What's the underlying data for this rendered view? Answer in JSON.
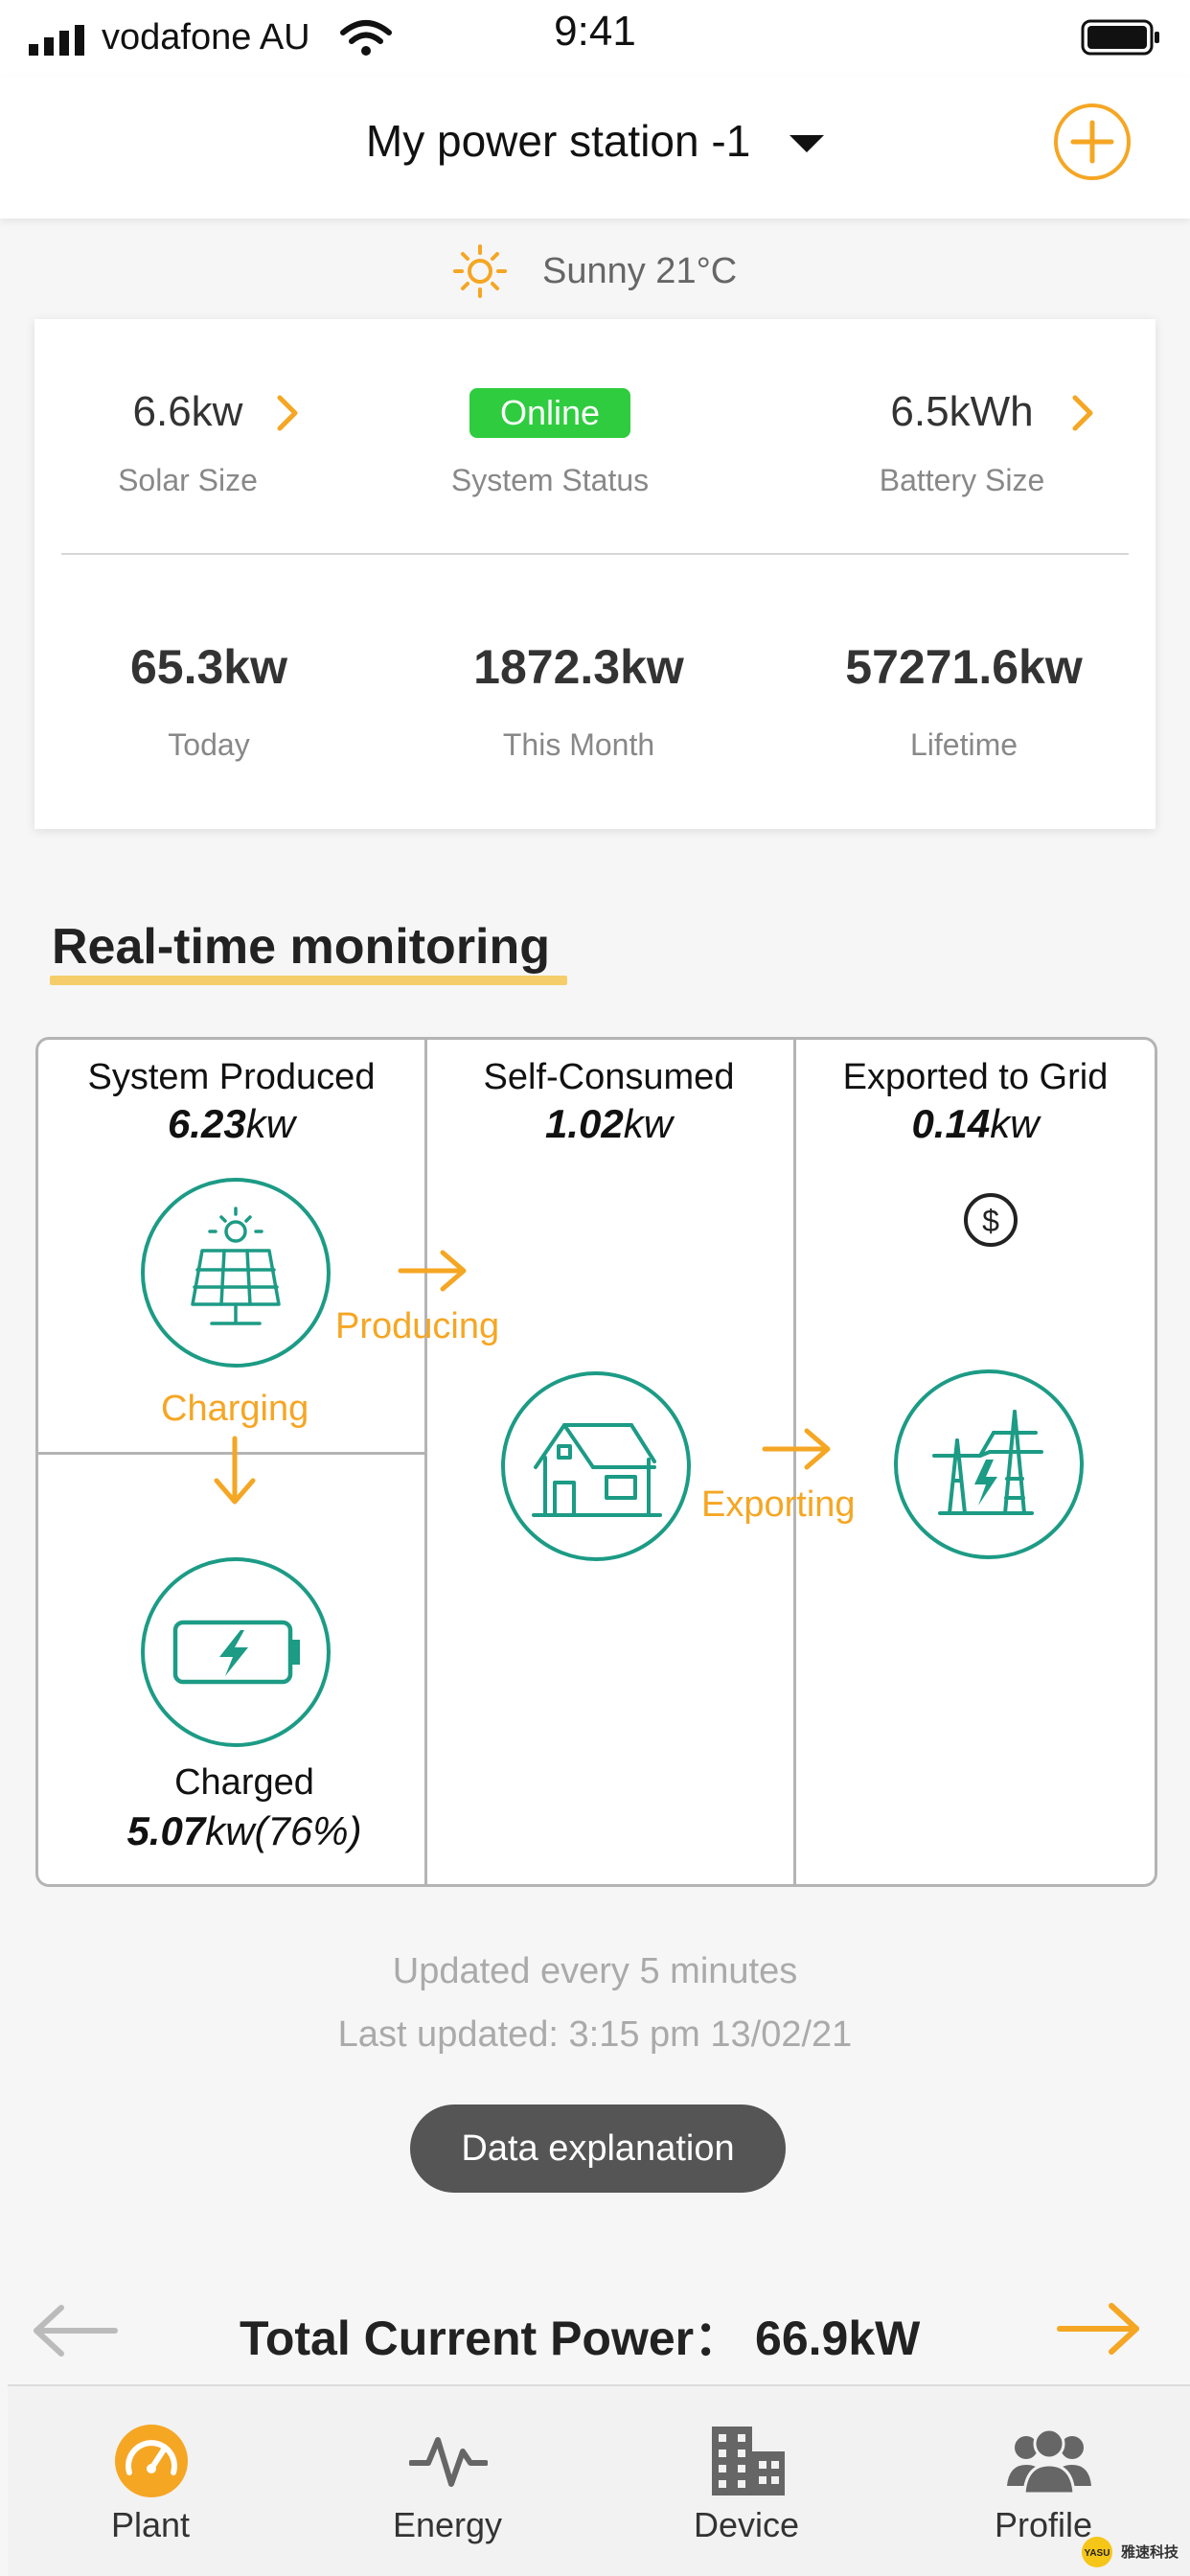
{
  "status_bar": {
    "carrier": "vodafone AU",
    "time": "9:41"
  },
  "header": {
    "station_name": "My power station -1"
  },
  "weather": {
    "text": "Sunny 21°C"
  },
  "summary": {
    "solar_size": {
      "value": "6.6kw",
      "label": "Solar Size"
    },
    "system_status": {
      "value": "Online",
      "label": "System Status"
    },
    "battery_size": {
      "value": "6.5kWh",
      "label": "Battery Size"
    },
    "today": {
      "value": "65.3kw",
      "label": "Today"
    },
    "this_month": {
      "value": "1872.3kw",
      "label": "This Month"
    },
    "lifetime": {
      "value": "57271.6kw",
      "label": "Lifetime"
    }
  },
  "monitoring": {
    "title": "Real-time monitoring",
    "produced": {
      "title": "System Produced",
      "value": "6.23",
      "unit": "kw"
    },
    "consumed": {
      "title": "Self-Consumed",
      "value": "1.02",
      "unit": "kw"
    },
    "exported": {
      "title": "Exported to Grid",
      "value": "0.14",
      "unit": "kw"
    },
    "charged": {
      "title": "Charged",
      "value": "5.07",
      "unit_suffix": "kw(76%)"
    },
    "flow_labels": {
      "producing": "Producing",
      "charging": "Charging",
      "exporting": "Exporting"
    }
  },
  "update_info": {
    "frequency": "Updated every 5 minutes",
    "last_updated": "Last updated: 3:15 pm 13/02/21"
  },
  "data_explanation_label": "Data explanation",
  "total_power": {
    "text": "Total Current Power：",
    "value": "66.9kW"
  },
  "tabs": [
    {
      "label": "Plant",
      "icon": "gauge-icon",
      "active": true
    },
    {
      "label": "Energy",
      "icon": "pulse-icon",
      "active": false
    },
    {
      "label": "Device",
      "icon": "building-icon",
      "active": false
    },
    {
      "label": "Profile",
      "icon": "users-icon",
      "active": false
    }
  ],
  "watermark": "雅速科技",
  "colors": {
    "accent": "#f5a623",
    "teal": "#1c9b85",
    "online": "#2fcc3f",
    "underline": "#f5cd6b"
  }
}
